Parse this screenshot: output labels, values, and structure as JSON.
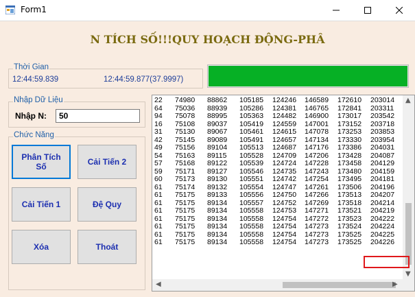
{
  "window": {
    "title": "Form1"
  },
  "banner": {
    "text": "N TÍCH SỐ!!!QUY HOẠCH ĐỘNG-PHÂ"
  },
  "time_group": {
    "title": "Thời Gian",
    "start_time": "12:44:59.839",
    "end_time": "12:44:59.877(37.9997)"
  },
  "progress": {
    "value_percent": 100,
    "color": "#06b025"
  },
  "input_group": {
    "title": "Nhập Dữ Liệu",
    "n_label": "Nhập N:",
    "n_value": "50"
  },
  "functions_group": {
    "title": "Chức Năng",
    "buttons": {
      "analyze": "Phân Tích Số",
      "improve2": "Cải Tiến 2",
      "improve1": "Cải Tiến 1",
      "recursion": "Đệ Quy",
      "clear": "Xóa",
      "exit": "Thoát"
    }
  },
  "results": [
    [
      "22",
      "74980",
      "88862",
      "105185",
      "124246",
      "146589",
      "172610",
      "203014"
    ],
    [
      "64",
      "75036",
      "88939",
      "105286",
      "124381",
      "146765",
      "172841",
      "203311"
    ],
    [
      "94",
      "75078",
      "88995",
      "105363",
      "124482",
      "146900",
      "173017",
      "203542"
    ],
    [
      "16",
      "75108",
      "89037",
      "105419",
      "124559",
      "147001",
      "173152",
      "203718"
    ],
    [
      "31",
      "75130",
      "89067",
      "105461",
      "124615",
      "147078",
      "173253",
      "203853"
    ],
    [
      "42",
      "75145",
      "89089",
      "105491",
      "124657",
      "147134",
      "173330",
      "203954"
    ],
    [
      "49",
      "75156",
      "89104",
      "105513",
      "124687",
      "147176",
      "173386",
      "204031"
    ],
    [
      "54",
      "75163",
      "89115",
      "105528",
      "124709",
      "147206",
      "173428",
      "204087"
    ],
    [
      "57",
      "75168",
      "89122",
      "105539",
      "124724",
      "147228",
      "173458",
      "204129"
    ],
    [
      "59",
      "75171",
      "89127",
      "105546",
      "124735",
      "147243",
      "173480",
      "204159"
    ],
    [
      "60",
      "75173",
      "89130",
      "105551",
      "124742",
      "147254",
      "173495",
      "204181"
    ],
    [
      "61",
      "75174",
      "89132",
      "105554",
      "124747",
      "147261",
      "173506",
      "204196"
    ],
    [
      "61",
      "75175",
      "89133",
      "105556",
      "124750",
      "147266",
      "173513",
      "204207"
    ],
    [
      "61",
      "75175",
      "89134",
      "105557",
      "124752",
      "147269",
      "173518",
      "204214"
    ],
    [
      "61",
      "75175",
      "89134",
      "105558",
      "124753",
      "147271",
      "173521",
      "204219"
    ],
    [
      "61",
      "75175",
      "89134",
      "105558",
      "124754",
      "147272",
      "173523",
      "204222"
    ],
    [
      "61",
      "75175",
      "89134",
      "105558",
      "124754",
      "147273",
      "173524",
      "204224"
    ],
    [
      "61",
      "75175",
      "89134",
      "105558",
      "124754",
      "147273",
      "173525",
      "204225"
    ],
    [
      "61",
      "75175",
      "89134",
      "105558",
      "124754",
      "147273",
      "173525",
      "204226"
    ]
  ],
  "highlight_color": "#e0181b"
}
